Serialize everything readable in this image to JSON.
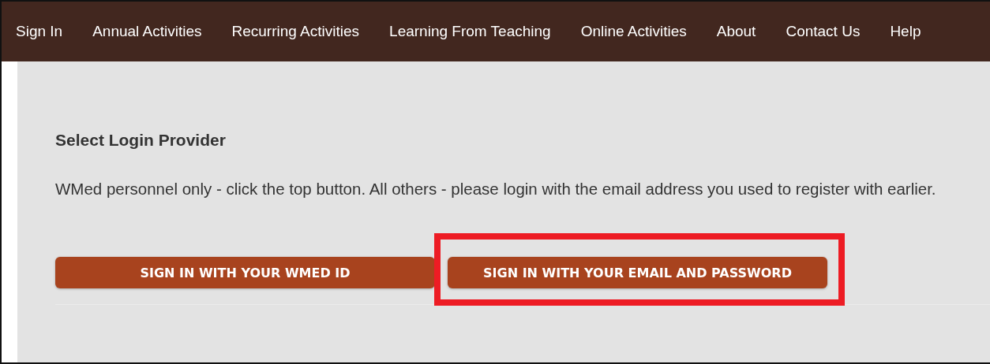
{
  "nav": [
    {
      "label": "Sign In"
    },
    {
      "label": "Annual Activities"
    },
    {
      "label": "Recurring Activities"
    },
    {
      "label": "Learning From Teaching"
    },
    {
      "label": "Online Activities"
    },
    {
      "label": "About"
    },
    {
      "label": "Contact Us"
    },
    {
      "label": "Help"
    }
  ],
  "heading": "Select Login Provider",
  "instructions": "WMed personnel only - click the top button. All others - please login with the email address you used to register with earlier.",
  "buttons": [
    {
      "label": "SIGN IN WITH YOUR WMED ID",
      "highlighted": false
    },
    {
      "label": "SIGN IN WITH YOUR EMAIL AND PASSWORD",
      "highlighted": true
    }
  ]
}
